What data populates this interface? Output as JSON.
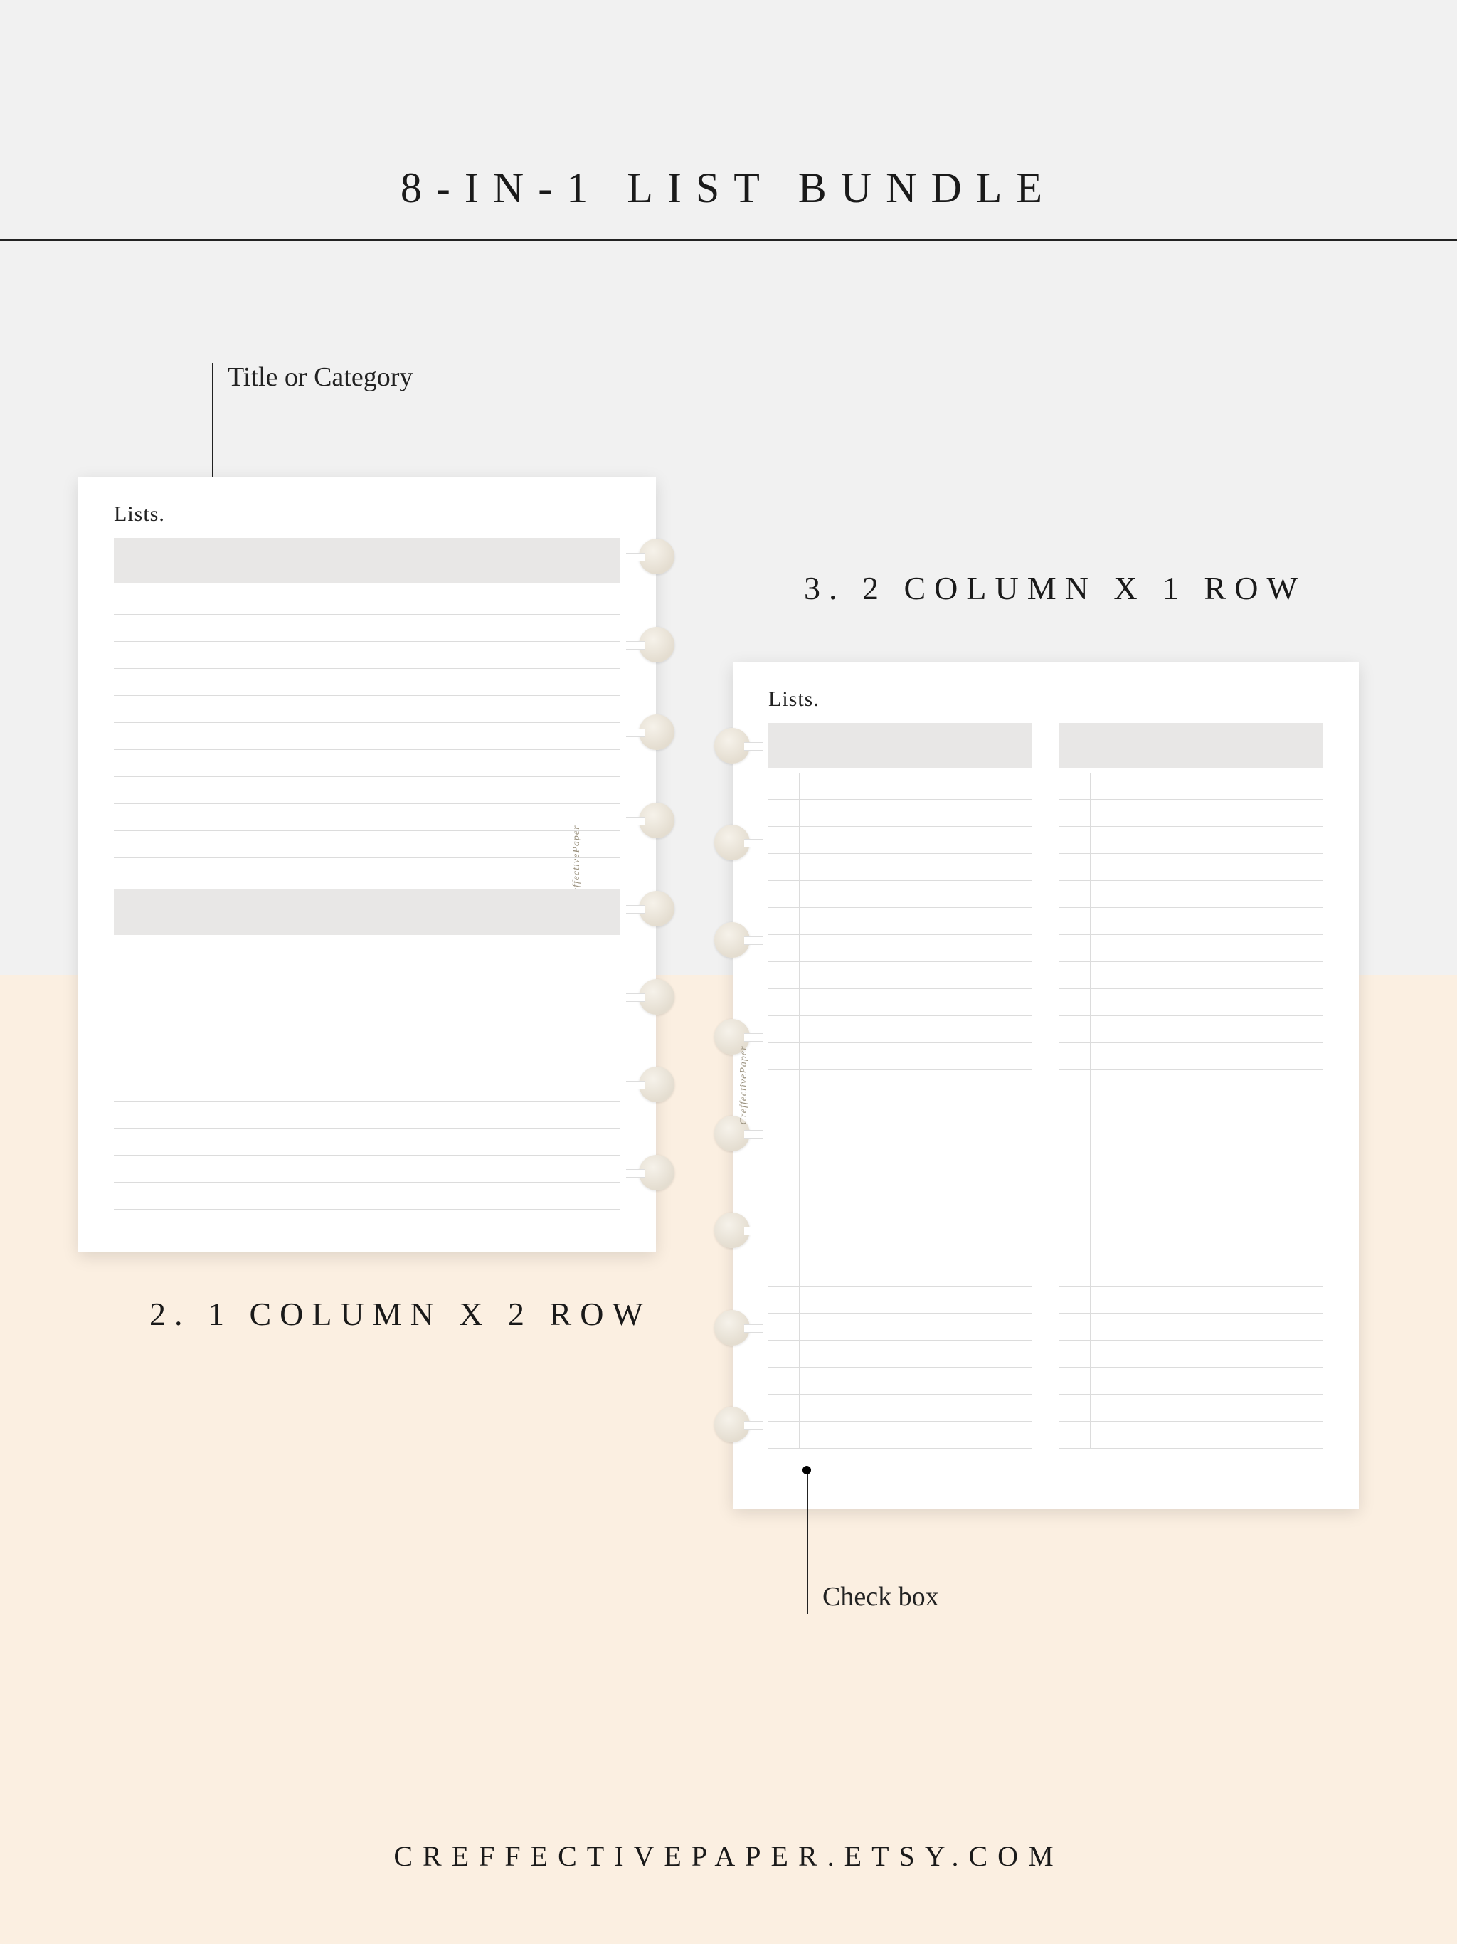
{
  "title": "8-IN-1 LIST BUNDLE",
  "footer": "CREFFECTIVEPAPER.ETSY.COM",
  "brand_mark": "CreffectivePaper",
  "annotations": {
    "title_category": "Title or Category",
    "check_box": "Check box"
  },
  "captions": {
    "left": "2. 1 COLUMN X 2 ROW",
    "right": "3. 2 COLUMN X 1 ROW"
  },
  "sheets": {
    "left": {
      "heading": "Lists.",
      "layout": "1 column x 2 row",
      "blocks": 2,
      "lines_per_block": 10,
      "ring_count": 8
    },
    "right": {
      "heading": "Lists.",
      "layout": "2 column x 1 row",
      "columns": 2,
      "lines_per_column": 25,
      "has_check_column": true,
      "ring_count": 8
    }
  },
  "colors": {
    "bg_top": "#f1f1f1",
    "bg_bottom": "#fbefe1",
    "header_fill": "#e8e7e6",
    "rule": "#dcdcdc",
    "text": "#1a1a1a"
  }
}
